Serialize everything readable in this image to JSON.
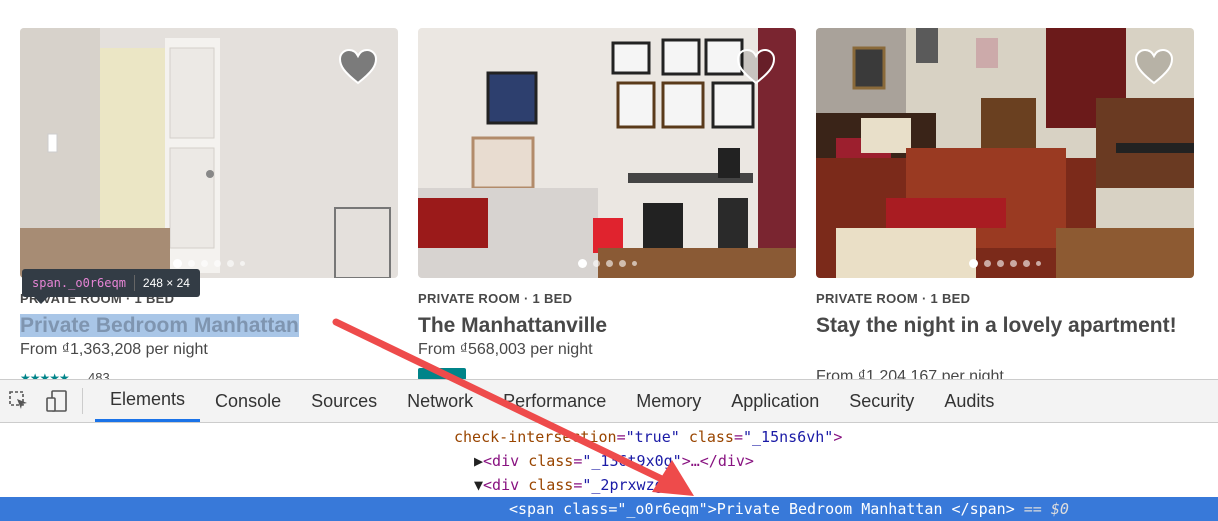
{
  "listings": [
    {
      "kicker": "PRIVATE ROOM · 1 BED",
      "title": "Private Bedroom Manhattan",
      "price": "From ₫1,363,208  per night",
      "rating_count": "483",
      "carousel_dots": 6
    },
    {
      "kicker": "PRIVATE ROOM · 1 BED",
      "title": "The Manhattanville",
      "price": "From ₫568,003  per night",
      "carousel_dots": 5
    },
    {
      "kicker": "PRIVATE ROOM · 1 BED",
      "title": "Stay the night in a lovely apartment!",
      "price": "From ₫1,204,167  per night",
      "carousel_dots": 6
    }
  ],
  "inspector_tooltip": {
    "selector": "span._o0r6eqm",
    "dimensions": "248 × 24"
  },
  "devtools": {
    "tabs": [
      "Elements",
      "Console",
      "Sources",
      "Network",
      "Performance",
      "Memory",
      "Application",
      "Security",
      "Audits"
    ],
    "active_tab": "Elements",
    "code_lines": {
      "line1_attr1": "check-intersection",
      "line1_val1": "\"true\"",
      "line1_attr2": "class",
      "line1_val2": "\"_15ns6vh\"",
      "line2_val": "\"_136t9x0g\"",
      "line3_val": "\"_2prxwzg\"",
      "line4_val": "\"_o0r6eqm\"",
      "line4_text": "Private Bedroom Manhattan ",
      "line4_suffix": "== $0"
    }
  },
  "colors": {
    "accent": "#1a73e8",
    "selection": "#3879d9",
    "arrow": "#ee4b4b",
    "teal": "#008489"
  }
}
